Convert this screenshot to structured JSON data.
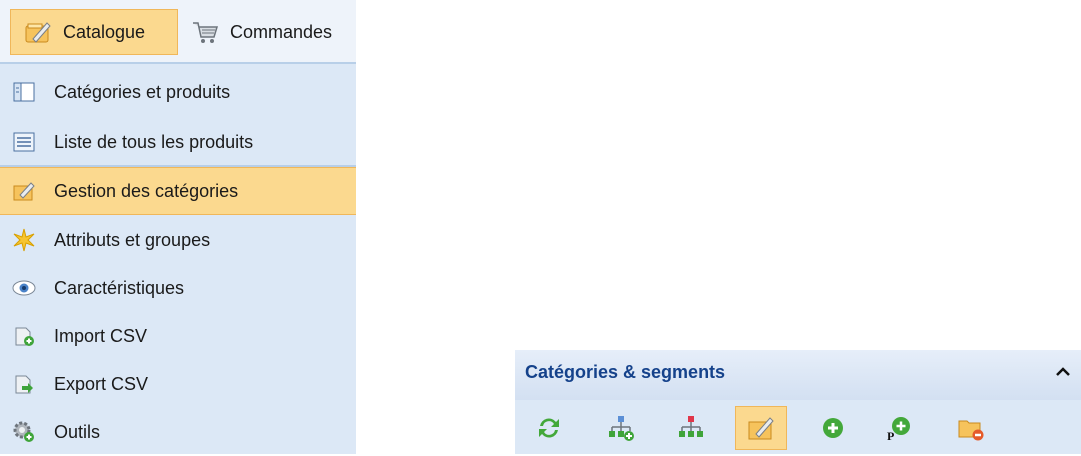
{
  "tabs": [
    {
      "label": "Catalogue",
      "icon": "pencil-catalog-icon",
      "active": true
    },
    {
      "label": "Commandes",
      "icon": "cart-icon",
      "active": false
    }
  ],
  "menu_items": [
    {
      "label": "Catégories et produits",
      "icon": "categories-products-icon"
    },
    {
      "label": "Liste de tous les produits",
      "icon": "list-icon"
    },
    {
      "label": "Gestion des catégories",
      "icon": "edit-categories-icon",
      "active": true
    },
    {
      "label": "Attributs et groupes",
      "icon": "attributes-icon"
    },
    {
      "label": "Caractéristiques",
      "icon": "eye-icon"
    },
    {
      "label": "Import CSV",
      "icon": "import-csv-icon"
    },
    {
      "label": "Export CSV",
      "icon": "export-csv-icon"
    },
    {
      "label": "Outils",
      "icon": "gear-icon"
    }
  ],
  "panel": {
    "title": "Catégories & segments",
    "collapse_icon": "chevron-up-icon",
    "toolbar": [
      {
        "icon": "refresh-icon"
      },
      {
        "icon": "add-tree-node-icon"
      },
      {
        "icon": "tree-node-red-icon"
      },
      {
        "icon": "edit-icon",
        "active": true
      },
      {
        "icon": "add-circle-icon"
      },
      {
        "icon": "add-p-icon"
      },
      {
        "icon": "folder-delete-icon"
      }
    ]
  },
  "colors": {
    "active_bg": "#fbd98f",
    "menu_bg": "#dce8f6",
    "title_color": "#15428b"
  }
}
